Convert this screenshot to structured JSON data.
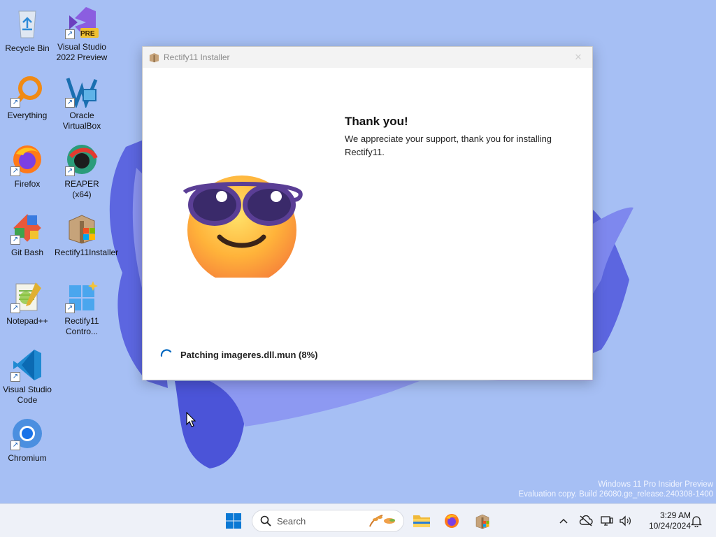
{
  "desktop": {
    "icons": [
      {
        "label": "Recycle Bin",
        "icon": "recycle-bin-icon"
      },
      {
        "label": "Visual Studio 2022 Preview",
        "icon": "visual-studio-icon",
        "badge": "PRE"
      },
      {
        "label": "Everything",
        "icon": "everything-search-icon"
      },
      {
        "label": "Oracle VirtualBox",
        "icon": "virtualbox-icon"
      },
      {
        "label": "Firefox",
        "icon": "firefox-icon"
      },
      {
        "label": "REAPER (x64)",
        "icon": "reaper-icon"
      },
      {
        "label": "Git Bash",
        "icon": "git-bash-icon"
      },
      {
        "label": "Rectify11Installer",
        "icon": "rectify11-installer-icon"
      },
      {
        "label": "Notepad++",
        "icon": "notepadpp-icon"
      },
      {
        "label": "Rectify11 Contro...",
        "icon": "rectify11-control-icon"
      },
      {
        "label": "Visual Studio Code",
        "icon": "vscode-icon"
      },
      {
        "label": "Chromium",
        "icon": "chromium-icon"
      }
    ],
    "shortcut_arrow": "↗"
  },
  "installer": {
    "title": "Rectify11 Installer",
    "close_glyph": "✕",
    "heading": "Thank you!",
    "message": "We appreciate your support, thank you for installing Rectify11.",
    "status": "Patching imageres.dll.mun (8%)",
    "progress_percent": 8
  },
  "watermark": {
    "line1": "Windows 11 Pro Insider Preview",
    "line2": "Evaluation copy. Build 26080.ge_release.240308-1400"
  },
  "taskbar": {
    "search_placeholder": "Search",
    "apps": [
      "start-icon",
      "file-explorer-icon",
      "firefox-icon",
      "rectify11-installer-icon"
    ],
    "tray_chevron": "^",
    "clock_time": "3:29 AM",
    "clock_date": "10/24/2024"
  },
  "colors": {
    "wallpaper": "#a6bff4",
    "accent": "#0067c0",
    "ribbon": "#4b54d8"
  }
}
